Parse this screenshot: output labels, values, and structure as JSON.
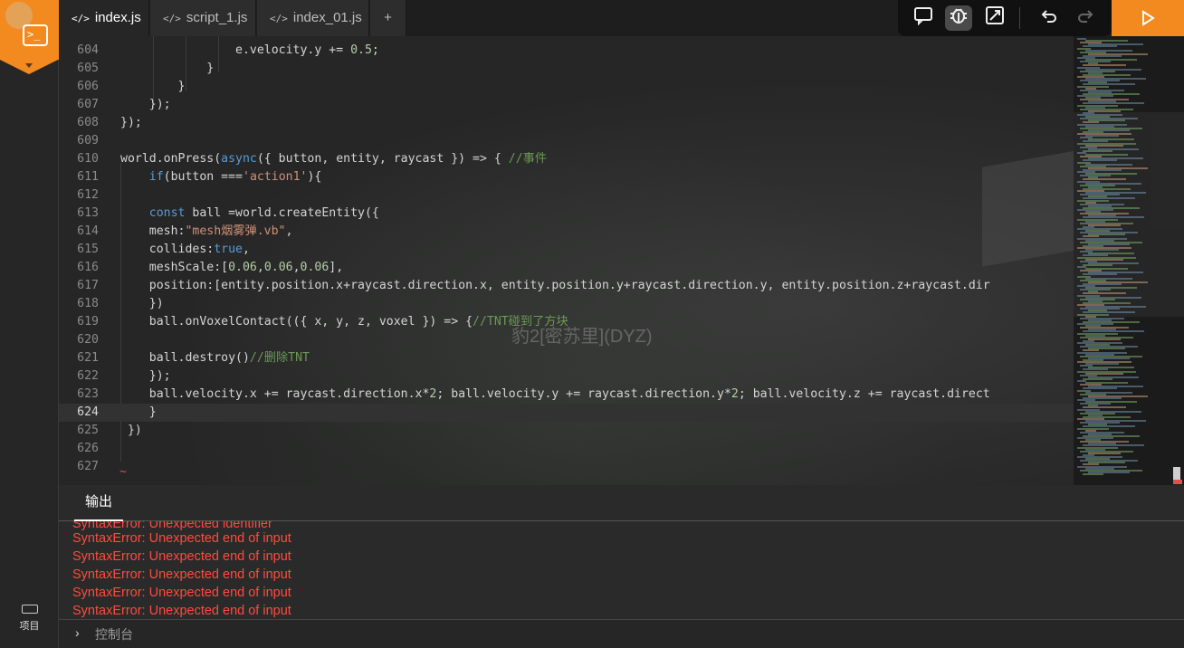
{
  "tabs": [
    {
      "label": "index.js",
      "active": true
    },
    {
      "label": "script_1.js",
      "active": false
    },
    {
      "label": "index_01.js",
      "active": false
    }
  ],
  "tab_add": "+",
  "toolbar": {
    "icons": [
      "comment-icon",
      "debug-icon",
      "resize-icon",
      "undo-icon",
      "redo-icon"
    ],
    "run_icon": "play-icon",
    "accent": "#f28a1f"
  },
  "sidebar": {
    "project_label": "项目"
  },
  "background_overlay_text": "豹2[密苏里](DYZ)",
  "editor": {
    "current_line": "624",
    "lines": [
      {
        "n": "604",
        "t": "                e.velocity.y += 0.5;"
      },
      {
        "n": "605",
        "t": "            }"
      },
      {
        "n": "606",
        "t": "        }"
      },
      {
        "n": "607",
        "t": "    });"
      },
      {
        "n": "608",
        "t": "});"
      },
      {
        "n": "609",
        "t": ""
      },
      {
        "n": "610",
        "t": "world.onPress(async({ button, entity, raycast }) => { //事件"
      },
      {
        "n": "611",
        "t": "    if(button ==='action1'){"
      },
      {
        "n": "612",
        "t": ""
      },
      {
        "n": "613",
        "t": "    const ball =world.createEntity({"
      },
      {
        "n": "614",
        "t": "    mesh:\"mesh烟雾弹.vb\","
      },
      {
        "n": "615",
        "t": "    collides:true,"
      },
      {
        "n": "616",
        "t": "    meshScale:[0.06,0.06,0.06],"
      },
      {
        "n": "617",
        "t": "    position:[entity.position.x+raycast.direction.x, entity.position.y+raycast.direction.y, entity.position.z+raycast.dir"
      },
      {
        "n": "618",
        "t": "    })"
      },
      {
        "n": "619",
        "t": "    ball.onVoxelContact(({ x, y, z, voxel }) => {//TNT碰到了方块"
      },
      {
        "n": "620",
        "t": ""
      },
      {
        "n": "621",
        "t": "    ball.destroy()//删除TNT"
      },
      {
        "n": "622",
        "t": "    });"
      },
      {
        "n": "623",
        "t": "    ball.velocity.x += raycast.direction.x*2; ball.velocity.y += raycast.direction.y*2; ball.velocity.z += raycast.direct"
      },
      {
        "n": "624",
        "t": "    }"
      },
      {
        "n": "625",
        "t": " })"
      },
      {
        "n": "626",
        "t": ""
      },
      {
        "n": "627",
        "t": ""
      }
    ],
    "error_marker": "~"
  },
  "output": {
    "tab_label": "输出",
    "lines": [
      "SyntaxError: Unexpected identifier",
      "SyntaxError: Unexpected end of input",
      "SyntaxError: Unexpected end of input",
      "SyntaxError: Unexpected end of input",
      "SyntaxError: Unexpected end of input",
      "SyntaxError: Unexpected end of input"
    ],
    "error_color": "#ff4a3d",
    "console_placeholder": "控制台"
  }
}
